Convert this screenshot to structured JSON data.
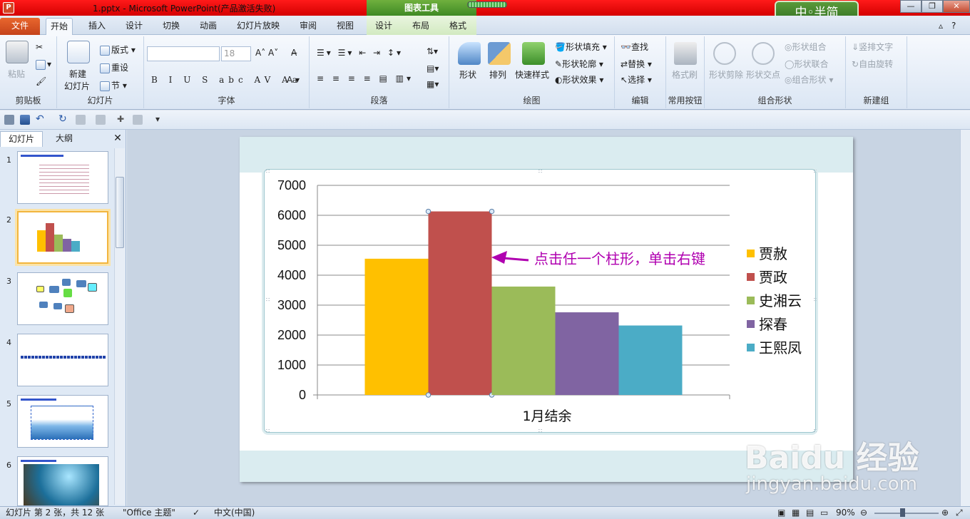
{
  "window": {
    "title": "1.pptx - Microsoft PowerPoint(产品激活失败)",
    "context_group": "图表工具",
    "app_icon": "P"
  },
  "logo": {
    "text": "中◦半简"
  },
  "tabs": [
    "文件",
    "开始",
    "插入",
    "设计",
    "切换",
    "动画",
    "幻灯片放映",
    "审阅",
    "视图",
    "设计",
    "布局",
    "格式"
  ],
  "ribbon": {
    "clipboard": {
      "label": "剪贴板",
      "paste": "粘贴"
    },
    "slides": {
      "label": "幻灯片",
      "new_slide_1": "新建",
      "new_slide_2": "幻灯片",
      "layout": "版式",
      "reset": "重设",
      "section": "节"
    },
    "font": {
      "label": "字体",
      "size": "18"
    },
    "paragraph": {
      "label": "段落"
    },
    "drawing": {
      "label": "绘图",
      "shapes": "形状",
      "arrange": "排列",
      "quick_styles": "快速样式",
      "fill": "形状填充",
      "outline": "形状轮廓",
      "effects": "形状效果"
    },
    "editing": {
      "label": "编辑",
      "find": "查找",
      "replace": "替换",
      "select": "选择"
    },
    "common": {
      "label": "常用按钮",
      "format_painter": "格式刷"
    },
    "combine": {
      "label": "组合形状",
      "shape_subtract": "形状剪除",
      "shape_intersect": "形状交点",
      "shape_combine": "形状组合",
      "shape_union": "形状联合",
      "group_shape": "组合形状"
    },
    "newgroup": {
      "label": "新建组",
      "vertical_text": "竖排文字",
      "free_rotate": "自由旋转"
    }
  },
  "panel": {
    "tab_slides": "幻灯片",
    "tab_outline": "大纲",
    "slide_numbers": [
      "1",
      "2",
      "3",
      "4",
      "5",
      "6"
    ]
  },
  "chart_data": {
    "type": "bar",
    "categories": [
      "1月结余"
    ],
    "series": [
      {
        "name": "贾赦",
        "values": [
          4550
        ],
        "color": "#ffc000"
      },
      {
        "name": "贾政",
        "values": [
          6130
        ],
        "color": "#c0504d"
      },
      {
        "name": "史湘云",
        "values": [
          3620
        ],
        "color": "#9bbb59"
      },
      {
        "name": "探春",
        "values": [
          2760
        ],
        "color": "#8064a2"
      },
      {
        "name": "王熙凤",
        "values": [
          2320
        ],
        "color": "#4bacc6"
      }
    ],
    "ylim": [
      0,
      7000
    ],
    "yticks": [
      "7000",
      "6000",
      "5000",
      "4000",
      "3000",
      "2000",
      "1000",
      "0"
    ],
    "grid": true,
    "legend": "right",
    "annotation": "点击任一个柱形，单击右键",
    "annotation_color": "#b000b0"
  },
  "status": {
    "slide_info": "幻灯片 第 2 张，共 12 张",
    "theme": "\"Office 主题\"",
    "language": "中文(中国)",
    "zoom": "90%"
  },
  "watermark": {
    "brand": "Baidu 经验",
    "url": "jingyan.baidu.com"
  }
}
